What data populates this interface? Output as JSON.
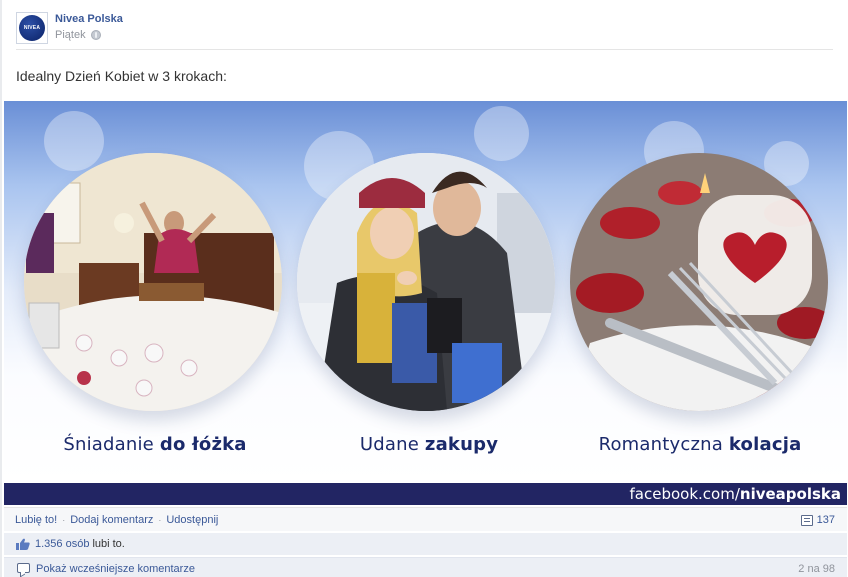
{
  "post": {
    "page_name": "Nivea Polska",
    "avatar_text": "NIVEA",
    "timestamp": "Piątek",
    "message": "Idealny Dzień Kobiet w 3 krokach:"
  },
  "image": {
    "captions": [
      {
        "plain": "Śniadanie ",
        "bold": "do łóżka"
      },
      {
        "plain": "Udane ",
        "bold": "zakupy"
      },
      {
        "plain": "Romantyczna ",
        "bold": "kolacja"
      }
    ],
    "banner": {
      "plain": "facebook.com/",
      "bold": "niveapolska"
    }
  },
  "actions": {
    "like": "Lubię to!",
    "comment": "Dodaj komentarz",
    "share": "Udostępnij",
    "share_count": "137"
  },
  "likes": {
    "count": "1.356 osób",
    "suffix": "lubi to."
  },
  "comments": {
    "show_earlier": "Pokaż wcześniejsze komentarze",
    "count": "2 na 98"
  },
  "colors": {
    "link": "#3b5998",
    "banner": "#222563",
    "caption": "#1b2a6b"
  }
}
